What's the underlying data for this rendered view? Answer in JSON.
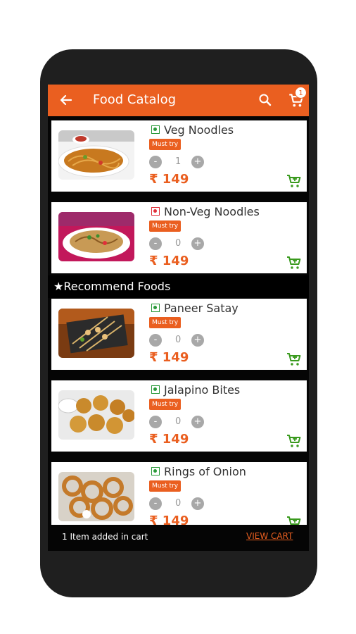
{
  "appbar": {
    "title": "Food Catalog",
    "cart_count": "1"
  },
  "items_top": [
    {
      "name": "Veg Noodles",
      "tag": "Must try",
      "qty": "1",
      "price": "₹ 149",
      "type": "veg"
    },
    {
      "name": "Non-Veg Noodles",
      "tag": "Must try",
      "qty": "0",
      "price": "₹ 149",
      "type": "nonveg"
    }
  ],
  "section": {
    "label": "★Recommend Foods"
  },
  "items_recommended": [
    {
      "name": "Paneer Satay",
      "tag": "Must try",
      "qty": "0",
      "price": "₹ 149",
      "type": "veg"
    },
    {
      "name": "Jalapino Bites",
      "tag": "Must try",
      "qty": "0",
      "price": "₹ 149",
      "type": "veg"
    },
    {
      "name": "Rings of Onion",
      "tag": "Must try",
      "qty": "0",
      "price": "₹ 149",
      "type": "veg"
    }
  ],
  "stepper": {
    "minus": "-",
    "plus": "+"
  },
  "cart_bar": {
    "message": "1 Item added in cart",
    "action": "VIEW CART"
  },
  "colors": {
    "accent": "#ea5f20",
    "veg": "#2a9a3a",
    "nonveg": "#e0303a",
    "add_cart": "#3a9a1e"
  },
  "icons": [
    "back-arrow-icon",
    "search-icon",
    "cart-icon",
    "add-to-cart-icon",
    "veg-mark-icon",
    "non-veg-mark-icon"
  ]
}
